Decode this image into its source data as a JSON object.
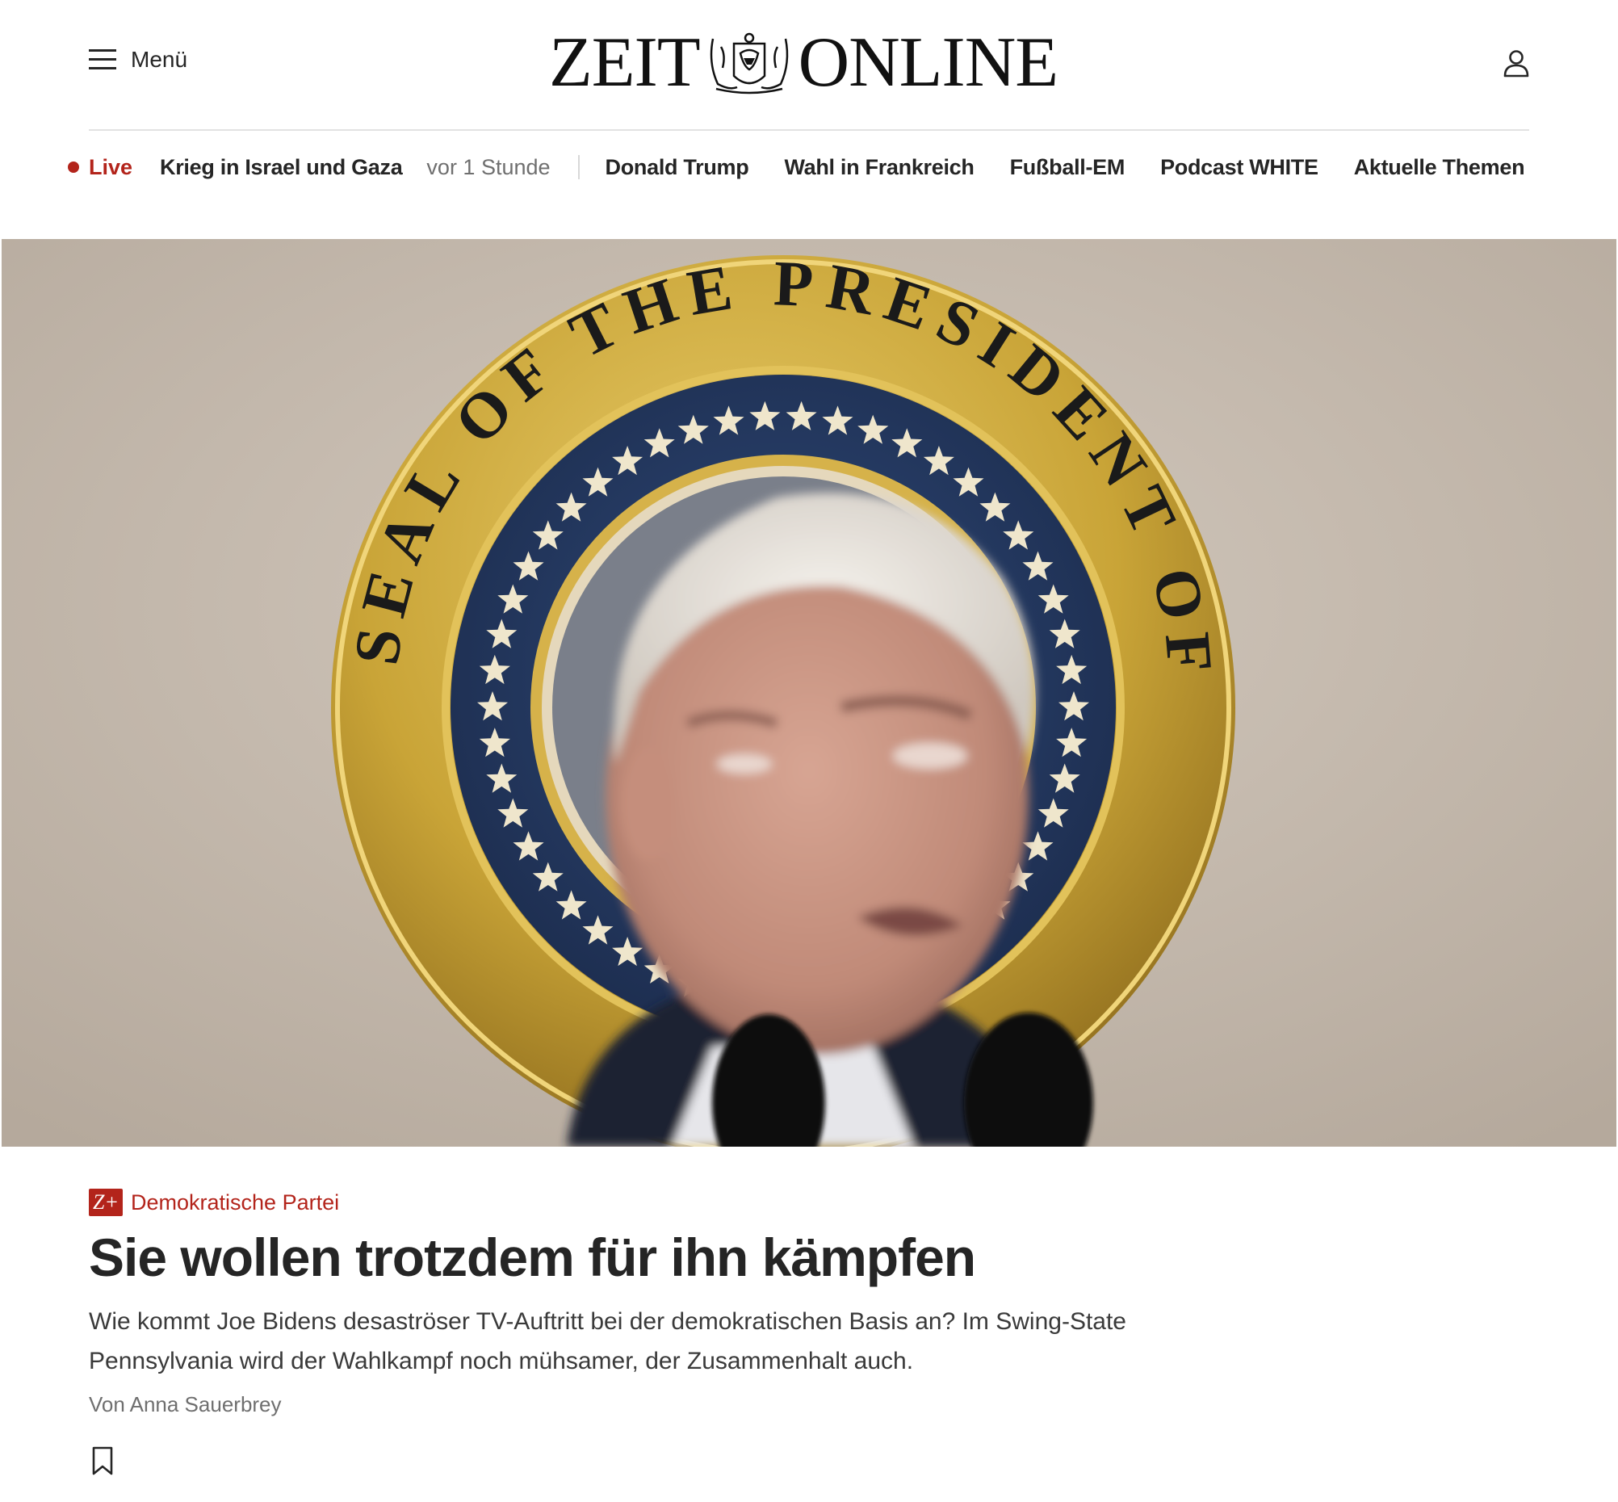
{
  "header": {
    "menu_label": "Menü",
    "logo_left": "ZEIT",
    "logo_right": "ONLINE"
  },
  "topics": {
    "live_label": "Live",
    "live_topic": "Krieg in Israel und Gaza",
    "live_time": "vor 1 Stunde",
    "items": [
      "Donald Trump",
      "Wahl in Frankreich",
      "Fußball-EM",
      "Podcast WHITE",
      "Aktuelle Themen"
    ]
  },
  "hero": {
    "seal_text": "SEAL OF THE PRESIDENT OF THE UNITED STATES"
  },
  "article": {
    "badge": "Z+",
    "kicker": "Demokratische Partei",
    "headline": "Sie wollen trotzdem für ihn kämpfen",
    "summary": "Wie kommt Joe Bidens desaströser TV-Auftritt bei der demokratischen Basis an? Im Swing-State Pennsylvania wird der Wahlkampf noch mühsamer, der Zusammenhalt auch.",
    "byline": "Von Anna Sauerbrey"
  },
  "colors": {
    "accent": "#b3241b",
    "text": "#252525",
    "muted": "#6f6f6f",
    "seal_blue": "#263a63",
    "seal_gold": "#c9a437",
    "wall": "#cbbfb2"
  },
  "icons": [
    "hamburger-menu-icon",
    "zeit-eagle-crest-icon",
    "user-account-icon",
    "live-dot-icon",
    "z-plus-icon",
    "bookmark-icon"
  ]
}
